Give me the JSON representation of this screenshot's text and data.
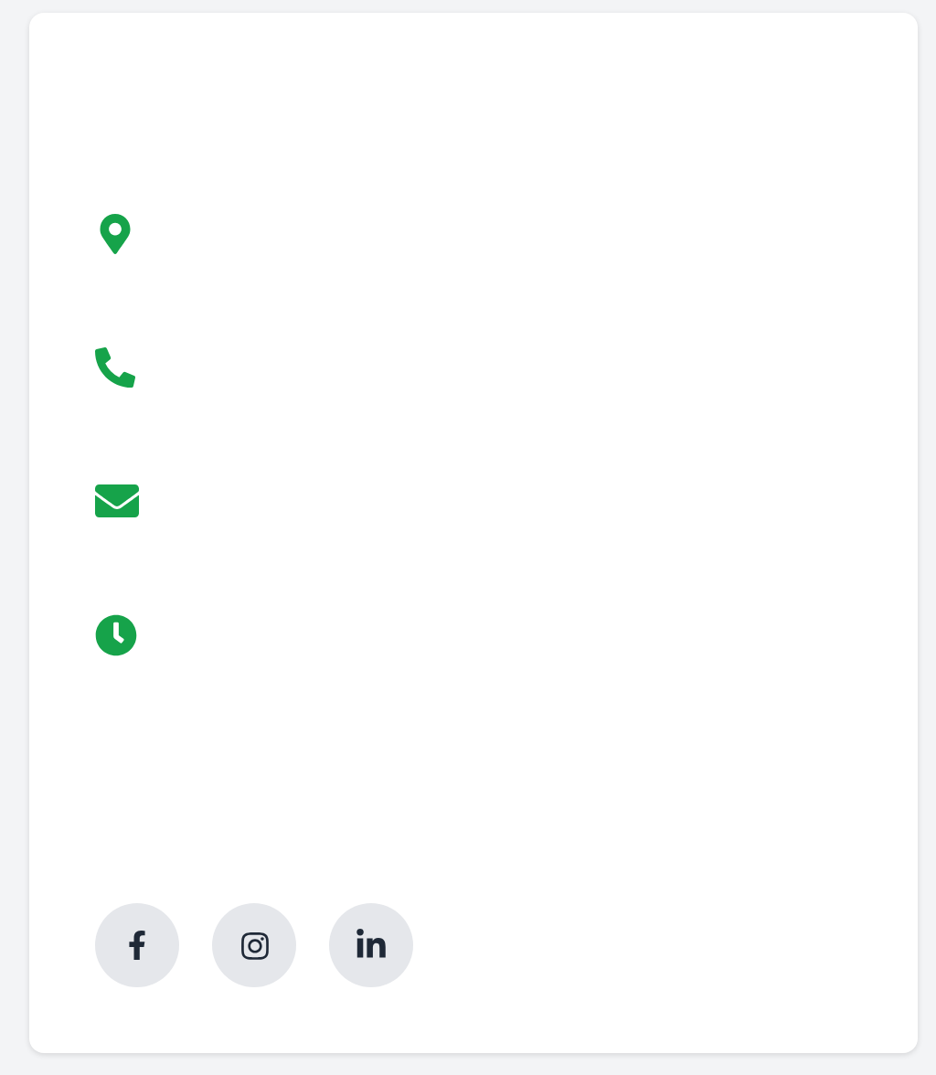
{
  "contact_items": [
    {
      "kind": "location"
    },
    {
      "kind": "phone"
    },
    {
      "kind": "email"
    },
    {
      "kind": "hours"
    }
  ],
  "social_links": [
    {
      "kind": "facebook"
    },
    {
      "kind": "instagram"
    },
    {
      "kind": "linkedin"
    }
  ]
}
